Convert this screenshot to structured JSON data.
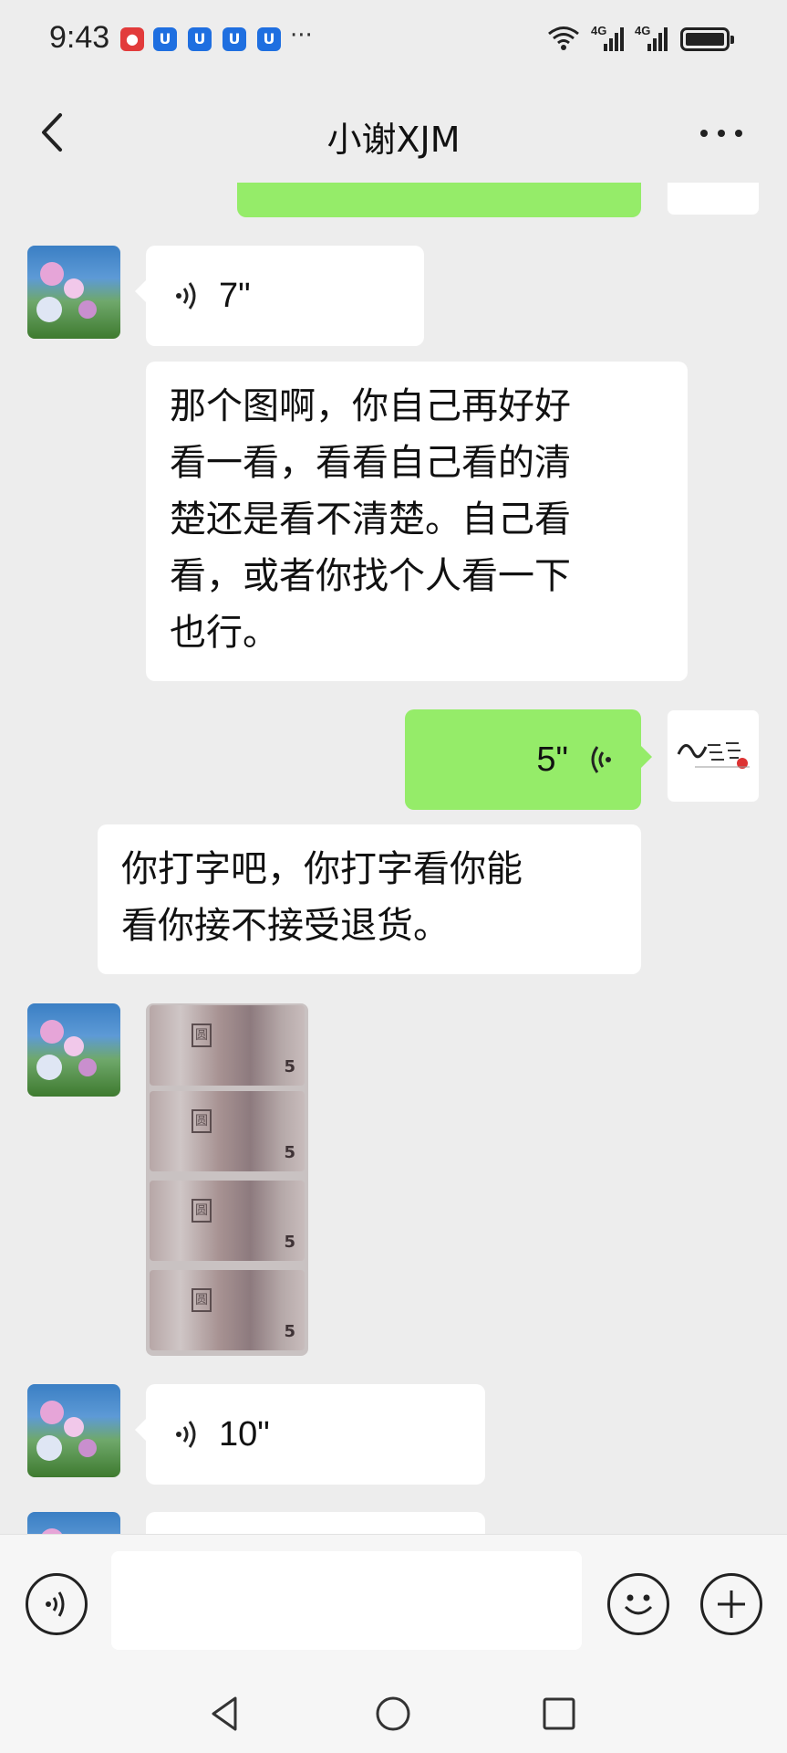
{
  "status": {
    "time": "9:43",
    "network1": "4G",
    "network2": "4G",
    "more": "···"
  },
  "header": {
    "title": "小谢XJM"
  },
  "messages": {
    "voice1": "7\"",
    "text1": [
      "那个图啊，你自己再好好",
      "看一看，看看自己看的清",
      "楚还是看不清楚。自己看",
      "看，或者你找个人看一下",
      "也行。"
    ],
    "voice_sent": "5\"",
    "text2": [
      "你打字吧，你打字看你能",
      "看你接不接受退货。"
    ],
    "voice2": "10\""
  },
  "notes": {
    "denomination": "5",
    "mark": "圆"
  },
  "colors": {
    "sent_bubble": "#95ec69",
    "received_bubble": "#ffffff",
    "background": "#ededed"
  },
  "input": {
    "placeholder": ""
  }
}
